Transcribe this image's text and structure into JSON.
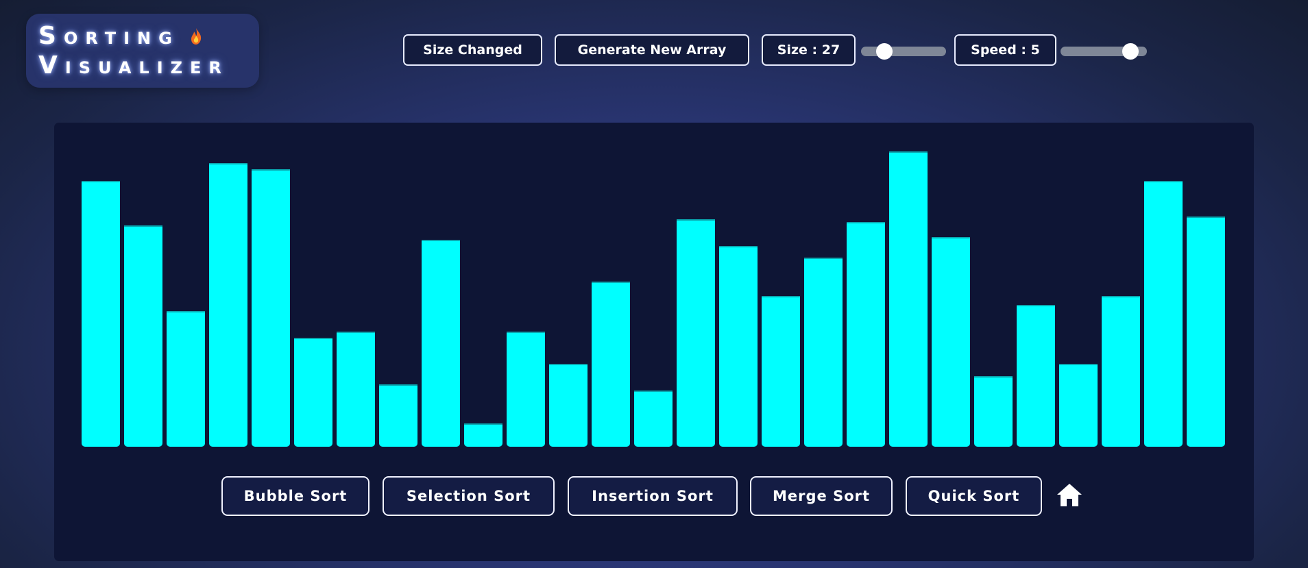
{
  "logo": {
    "line1_initial": "S",
    "line1_rest": "ORTING",
    "line2_initial": "V",
    "line2_rest": "ISUALIZER",
    "emoji_icon": "fire-icon"
  },
  "toolbar": {
    "size_changed_label": "Size Changed",
    "generate_label": "Generate New Array",
    "size_label": "Size : 27",
    "speed_label": "Speed : 5",
    "size_slider_fraction": 0.22,
    "speed_slider_fraction": 0.88
  },
  "array": {
    "count": 27,
    "bar_color": "#00ffff",
    "values": [
      90,
      75,
      46,
      96,
      94,
      37,
      39,
      21,
      70,
      8,
      39,
      28,
      56,
      19,
      77,
      68,
      51,
      64,
      76,
      100,
      71,
      24,
      48,
      28,
      51,
      90,
      78
    ]
  },
  "algorithms": {
    "bubble": "Bubble Sort",
    "selection": "Selection Sort",
    "insertion": "Insertion Sort",
    "merge": "Merge Sort",
    "quick": "Quick Sort"
  },
  "nav": {
    "home_icon": "home-icon"
  },
  "colors": {
    "accent": "#00ffff",
    "panel": "#0e1535",
    "button_bg": "#131b3d"
  }
}
